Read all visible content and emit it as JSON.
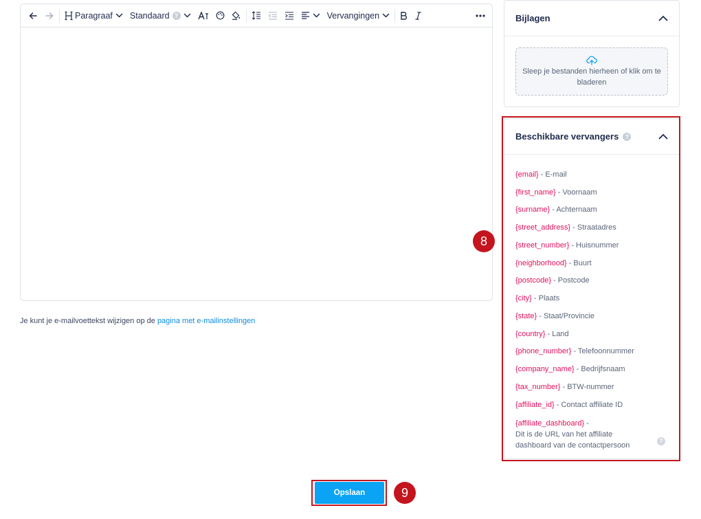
{
  "toolbar": {
    "paragraph": "Paragraaf",
    "font": "Standaard",
    "font_help": "?",
    "replacements": "Vervangingen"
  },
  "footer": {
    "text": "Je kunt je e-mailvoettekst wijzigen op de ",
    "link": "pagina met e-mailinstellingen"
  },
  "attachments": {
    "title": "Bijlagen",
    "dropzone_text": "Sleep je bestanden hierheen of klik om te bladeren"
  },
  "replacers": {
    "title": "Beschikbare vervangers",
    "help": "?",
    "items": [
      {
        "code": "{email}",
        "label": " - E-mail"
      },
      {
        "code": "{first_name}",
        "label": " - Voornaam"
      },
      {
        "code": "{surname}",
        "label": " - Achternaam"
      },
      {
        "code": "{street_address}",
        "label": " - Straatadres"
      },
      {
        "code": "{street_number}",
        "label": " - Huisnummer"
      },
      {
        "code": "{neighborhood}",
        "label": " - Buurt"
      },
      {
        "code": "{postcode}",
        "label": " - Postcode"
      },
      {
        "code": "{city}",
        "label": " - Plaats"
      },
      {
        "code": "{state}",
        "label": " - Staat/Provincie"
      },
      {
        "code": "{country}",
        "label": " - Land"
      },
      {
        "code": "{phone_number}",
        "label": " - Telefoonnummer"
      },
      {
        "code": "{company_name}",
        "label": " - Bedrijfsnaam"
      },
      {
        "code": "{tax_number}",
        "label": " - BTW-nummer"
      },
      {
        "code": "{affiliate_id}",
        "label": " - Contact affiliate ID"
      }
    ],
    "last": {
      "code": "{affiliate_dashboard}",
      "suffix": " -",
      "description": "Dit is de URL van het affiliate dashboard van de contactpersoon",
      "help": "?"
    }
  },
  "markers": {
    "replacers": "8",
    "save": "9"
  },
  "save_label": "Opslaan",
  "colors": {
    "accent": "#0aa3f5",
    "variable": "#e0115f",
    "annotation": "#c4141d",
    "link": "#0c8ce0"
  }
}
